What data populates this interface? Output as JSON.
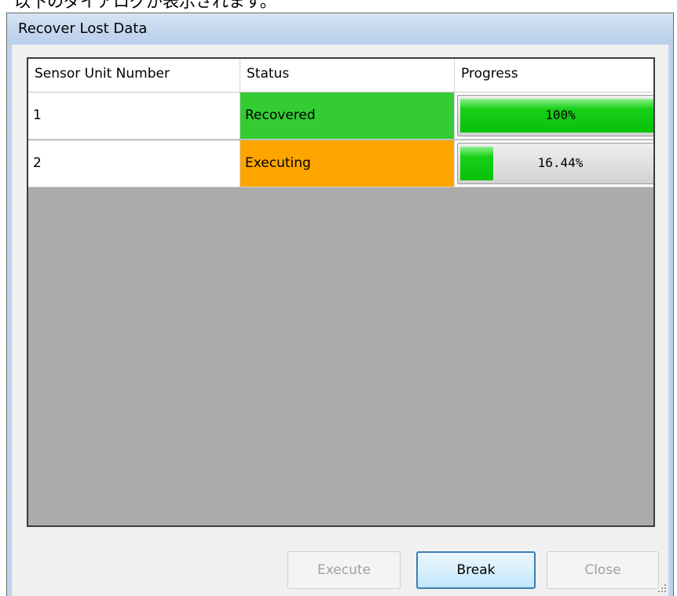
{
  "caption": "以下のダイアログが表示されます。",
  "dialog": {
    "title": "Recover Lost Data"
  },
  "table": {
    "columns": [
      "Sensor Unit Number",
      "Status",
      "Progress"
    ],
    "rows": [
      {
        "unit": "1",
        "status": "Recovered",
        "status_color": "#33cc33",
        "progress_label": "100%",
        "progress_fraction": 1.0
      },
      {
        "unit": "2",
        "status": "Executing",
        "status_color": "#ffa500",
        "progress_label": "16.44%",
        "progress_fraction": 0.1644
      }
    ]
  },
  "buttons": {
    "execute": {
      "label": "Execute",
      "enabled": false
    },
    "break": {
      "label": "Break",
      "enabled": true,
      "default": true
    },
    "close": {
      "label": "Close",
      "enabled": false
    }
  },
  "colors": {
    "grid_background": "#ababab",
    "progress_fill": "#07c107",
    "titlebar": "#c4d7ee"
  }
}
